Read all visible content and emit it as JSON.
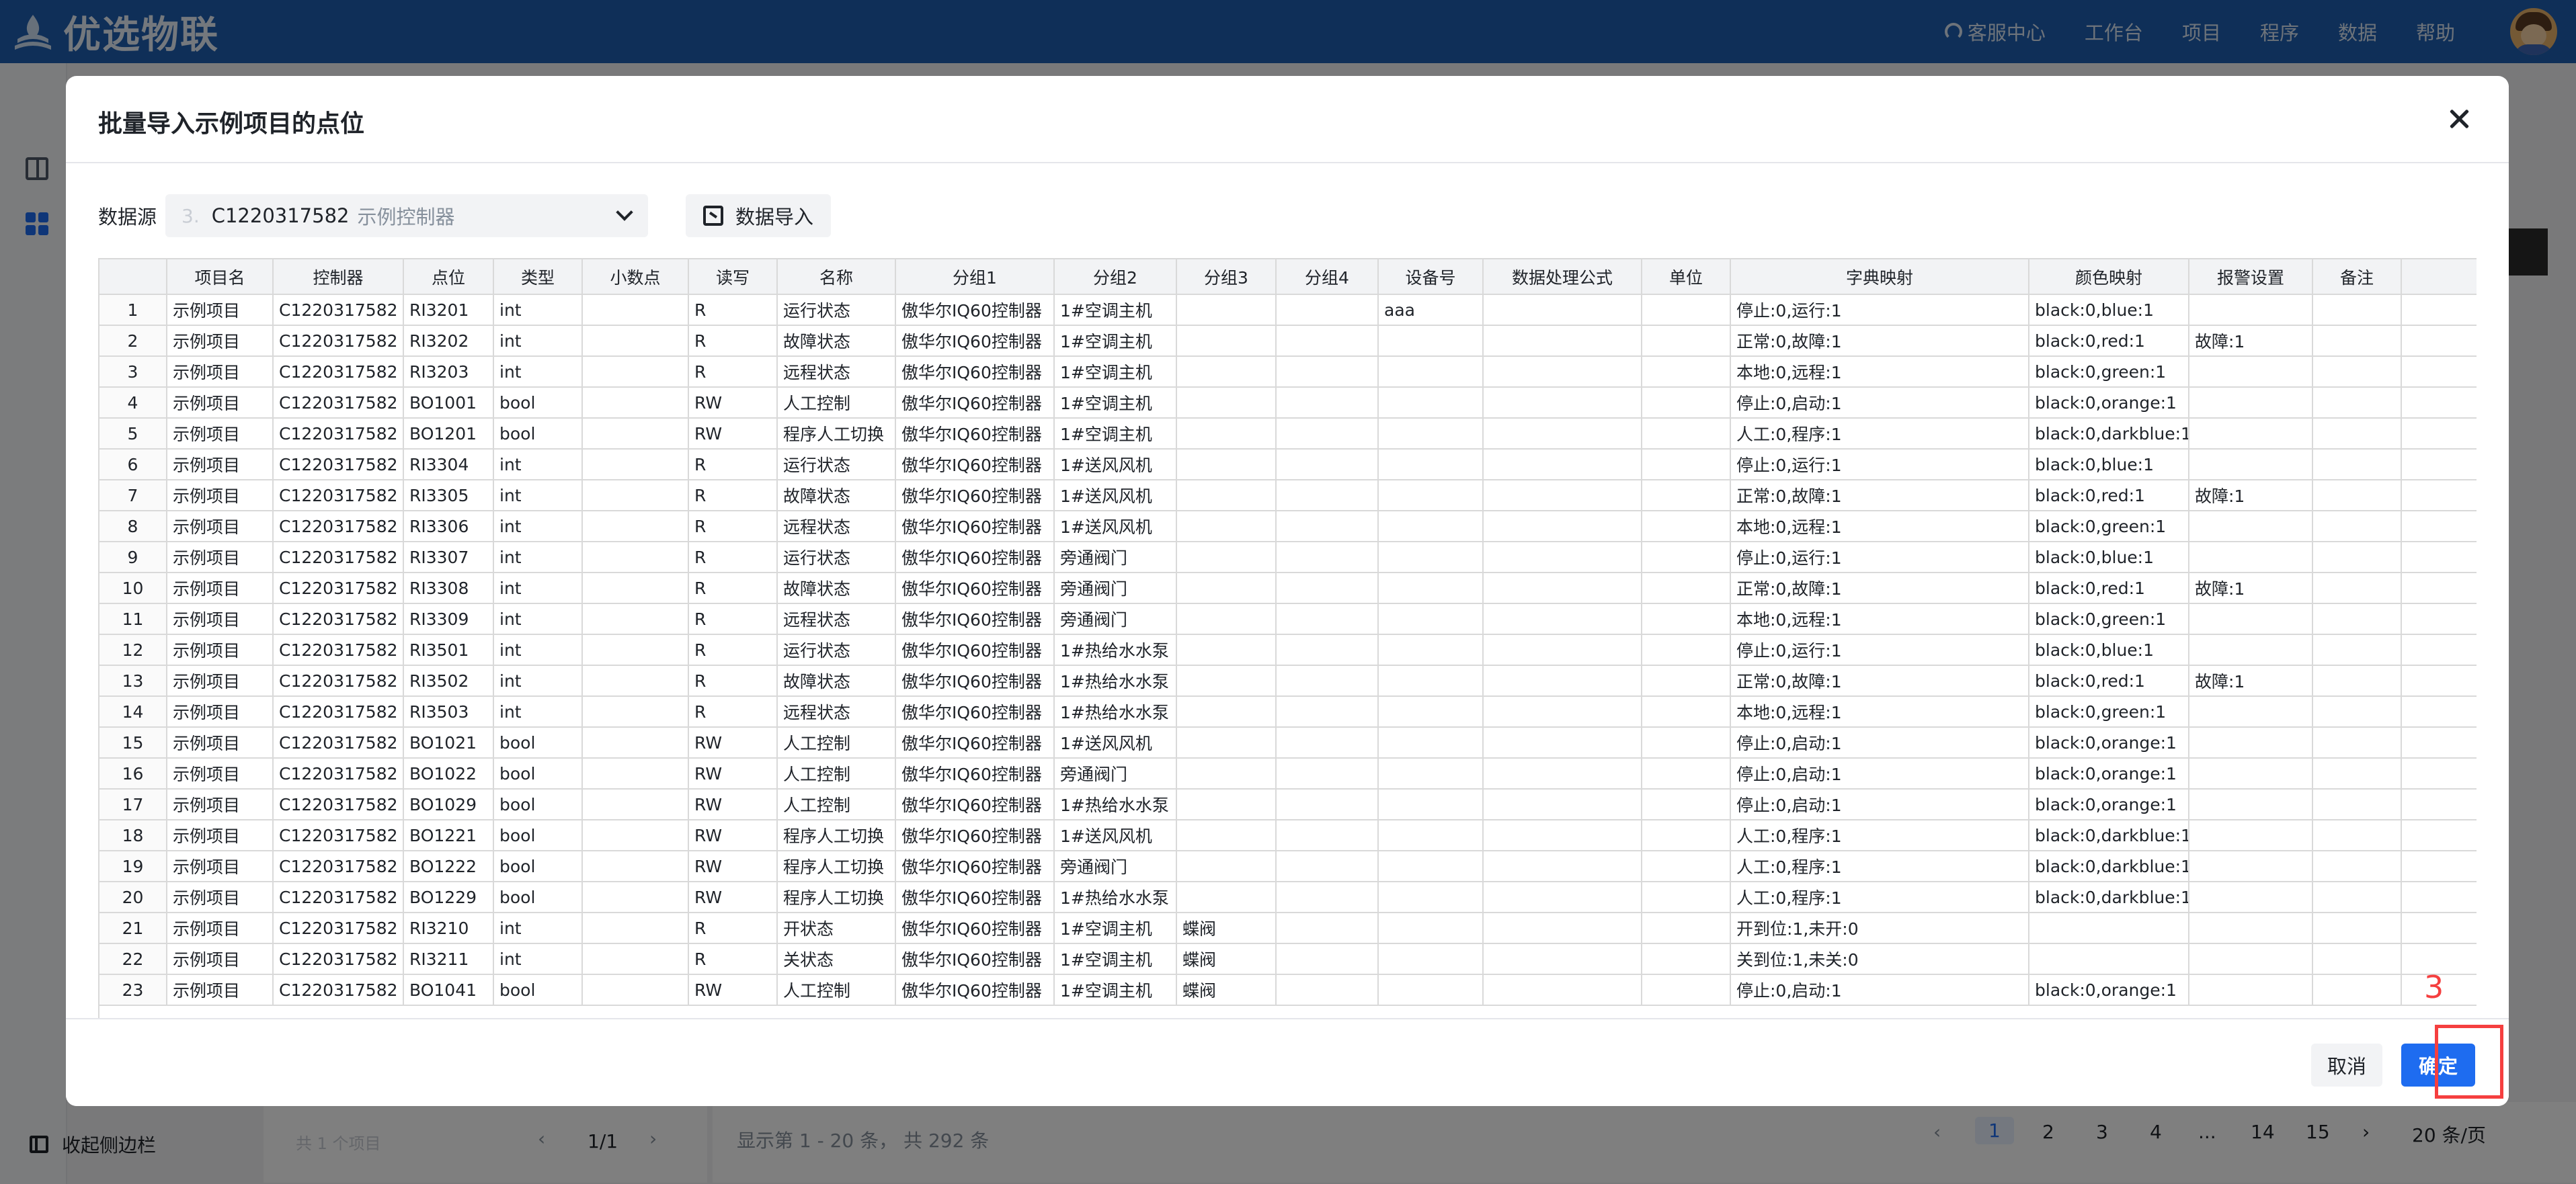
{
  "app": {
    "logo_text": "优选物联",
    "nav": [
      {
        "label": "客服中心",
        "icon": "headset-icon"
      },
      {
        "label": "工作台"
      },
      {
        "label": "项目"
      },
      {
        "label": "程序"
      },
      {
        "label": "数据"
      },
      {
        "label": "帮助"
      }
    ],
    "collapse_label": "收起侧边栏",
    "left_footer": {
      "count": "共 1 个项目",
      "page": "1/1"
    },
    "right_footer": {
      "summary": "显示第 1 - 20 条， 共 292 条",
      "pages": [
        "1",
        "2",
        "3",
        "4",
        "...",
        "14",
        "15"
      ],
      "page_size": "20 条/页"
    }
  },
  "modal": {
    "title": "批量导入示例项目的点位",
    "datasource_label": "数据源",
    "datasource_index": "3.",
    "datasource_value": "C1220317582",
    "datasource_sub": "示例控制器",
    "import_button": "数据导入",
    "cancel_button": "取消",
    "ok_button": "确定"
  },
  "annotation": {
    "number": "3",
    "color": "#f53f3f"
  },
  "colors": {
    "primary": "#1e6cf0",
    "topbar": "#1f5fb0"
  },
  "table": {
    "columns": [
      "",
      "项目名",
      "控制器",
      "点位",
      "类型",
      "小数点",
      "读写",
      "名称",
      "分组1",
      "分组2",
      "分组3",
      "分组4",
      "设备号",
      "数据处理公式",
      "单位",
      "字典映射",
      "颜色映射",
      "报警设置",
      "备注",
      ""
    ],
    "rows": [
      [
        "1",
        "示例项目",
        "C1220317582",
        "RI3201",
        "int",
        "",
        "R",
        "运行状态",
        "傲华尔IQ60控制器",
        "1#空调主机",
        "",
        "",
        "aaa",
        "",
        "",
        "停止:0,运行:1",
        "black:0,blue:1",
        "",
        ""
      ],
      [
        "2",
        "示例项目",
        "C1220317582",
        "RI3202",
        "int",
        "",
        "R",
        "故障状态",
        "傲华尔IQ60控制器",
        "1#空调主机",
        "",
        "",
        "",
        "",
        "",
        "正常:0,故障:1",
        "black:0,red:1",
        "故障:1",
        ""
      ],
      [
        "3",
        "示例项目",
        "C1220317582",
        "RI3203",
        "int",
        "",
        "R",
        "远程状态",
        "傲华尔IQ60控制器",
        "1#空调主机",
        "",
        "",
        "",
        "",
        "",
        "本地:0,远程:1",
        "black:0,green:1",
        "",
        ""
      ],
      [
        "4",
        "示例项目",
        "C1220317582",
        "BO1001",
        "bool",
        "",
        "RW",
        "人工控制",
        "傲华尔IQ60控制器",
        "1#空调主机",
        "",
        "",
        "",
        "",
        "",
        "停止:0,启动:1",
        "black:0,orange:1",
        "",
        ""
      ],
      [
        "5",
        "示例项目",
        "C1220317582",
        "BO1201",
        "bool",
        "",
        "RW",
        "程序人工切换",
        "傲华尔IQ60控制器",
        "1#空调主机",
        "",
        "",
        "",
        "",
        "",
        "人工:0,程序:1",
        "black:0,darkblue:1",
        "",
        ""
      ],
      [
        "6",
        "示例项目",
        "C1220317582",
        "RI3304",
        "int",
        "",
        "R",
        "运行状态",
        "傲华尔IQ60控制器",
        "1#送风风机",
        "",
        "",
        "",
        "",
        "",
        "停止:0,运行:1",
        "black:0,blue:1",
        "",
        ""
      ],
      [
        "7",
        "示例项目",
        "C1220317582",
        "RI3305",
        "int",
        "",
        "R",
        "故障状态",
        "傲华尔IQ60控制器",
        "1#送风风机",
        "",
        "",
        "",
        "",
        "",
        "正常:0,故障:1",
        "black:0,red:1",
        "故障:1",
        ""
      ],
      [
        "8",
        "示例项目",
        "C1220317582",
        "RI3306",
        "int",
        "",
        "R",
        "远程状态",
        "傲华尔IQ60控制器",
        "1#送风风机",
        "",
        "",
        "",
        "",
        "",
        "本地:0,远程:1",
        "black:0,green:1",
        "",
        ""
      ],
      [
        "9",
        "示例项目",
        "C1220317582",
        "RI3307",
        "int",
        "",
        "R",
        "运行状态",
        "傲华尔IQ60控制器",
        "旁通阀门",
        "",
        "",
        "",
        "",
        "",
        "停止:0,运行:1",
        "black:0,blue:1",
        "",
        ""
      ],
      [
        "10",
        "示例项目",
        "C1220317582",
        "RI3308",
        "int",
        "",
        "R",
        "故障状态",
        "傲华尔IQ60控制器",
        "旁通阀门",
        "",
        "",
        "",
        "",
        "",
        "正常:0,故障:1",
        "black:0,red:1",
        "故障:1",
        ""
      ],
      [
        "11",
        "示例项目",
        "C1220317582",
        "RI3309",
        "int",
        "",
        "R",
        "远程状态",
        "傲华尔IQ60控制器",
        "旁通阀门",
        "",
        "",
        "",
        "",
        "",
        "本地:0,远程:1",
        "black:0,green:1",
        "",
        ""
      ],
      [
        "12",
        "示例项目",
        "C1220317582",
        "RI3501",
        "int",
        "",
        "R",
        "运行状态",
        "傲华尔IQ60控制器",
        "1#热给水水泵",
        "",
        "",
        "",
        "",
        "",
        "停止:0,运行:1",
        "black:0,blue:1",
        "",
        ""
      ],
      [
        "13",
        "示例项目",
        "C1220317582",
        "RI3502",
        "int",
        "",
        "R",
        "故障状态",
        "傲华尔IQ60控制器",
        "1#热给水水泵",
        "",
        "",
        "",
        "",
        "",
        "正常:0,故障:1",
        "black:0,red:1",
        "故障:1",
        ""
      ],
      [
        "14",
        "示例项目",
        "C1220317582",
        "RI3503",
        "int",
        "",
        "R",
        "远程状态",
        "傲华尔IQ60控制器",
        "1#热给水水泵",
        "",
        "",
        "",
        "",
        "",
        "本地:0,远程:1",
        "black:0,green:1",
        "",
        ""
      ],
      [
        "15",
        "示例项目",
        "C1220317582",
        "BO1021",
        "bool",
        "",
        "RW",
        "人工控制",
        "傲华尔IQ60控制器",
        "1#送风风机",
        "",
        "",
        "",
        "",
        "",
        "停止:0,启动:1",
        "black:0,orange:1",
        "",
        ""
      ],
      [
        "16",
        "示例项目",
        "C1220317582",
        "BO1022",
        "bool",
        "",
        "RW",
        "人工控制",
        "傲华尔IQ60控制器",
        "旁通阀门",
        "",
        "",
        "",
        "",
        "",
        "停止:0,启动:1",
        "black:0,orange:1",
        "",
        ""
      ],
      [
        "17",
        "示例项目",
        "C1220317582",
        "BO1029",
        "bool",
        "",
        "RW",
        "人工控制",
        "傲华尔IQ60控制器",
        "1#热给水水泵",
        "",
        "",
        "",
        "",
        "",
        "停止:0,启动:1",
        "black:0,orange:1",
        "",
        ""
      ],
      [
        "18",
        "示例项目",
        "C1220317582",
        "BO1221",
        "bool",
        "",
        "RW",
        "程序人工切换",
        "傲华尔IQ60控制器",
        "1#送风风机",
        "",
        "",
        "",
        "",
        "",
        "人工:0,程序:1",
        "black:0,darkblue:1",
        "",
        ""
      ],
      [
        "19",
        "示例项目",
        "C1220317582",
        "BO1222",
        "bool",
        "",
        "RW",
        "程序人工切换",
        "傲华尔IQ60控制器",
        "旁通阀门",
        "",
        "",
        "",
        "",
        "",
        "人工:0,程序:1",
        "black:0,darkblue:1",
        "",
        ""
      ],
      [
        "20",
        "示例项目",
        "C1220317582",
        "BO1229",
        "bool",
        "",
        "RW",
        "程序人工切换",
        "傲华尔IQ60控制器",
        "1#热给水水泵",
        "",
        "",
        "",
        "",
        "",
        "人工:0,程序:1",
        "black:0,darkblue:1",
        "",
        ""
      ],
      [
        "21",
        "示例项目",
        "C1220317582",
        "RI3210",
        "int",
        "",
        "R",
        "开状态",
        "傲华尔IQ60控制器",
        "1#空调主机",
        "蝶阀",
        "",
        "",
        "",
        "",
        "开到位:1,未开:0",
        "",
        "",
        ""
      ],
      [
        "22",
        "示例项目",
        "C1220317582",
        "RI3211",
        "int",
        "",
        "R",
        "关状态",
        "傲华尔IQ60控制器",
        "1#空调主机",
        "蝶阀",
        "",
        "",
        "",
        "",
        "关到位:1,未关:0",
        "",
        "",
        ""
      ],
      [
        "23",
        "示例项目",
        "C1220317582",
        "BO1041",
        "bool",
        "",
        "RW",
        "人工控制",
        "傲华尔IQ60控制器",
        "1#空调主机",
        "蝶阀",
        "",
        "",
        "",
        "",
        "停止:0,启动:1",
        "black:0,orange:1",
        "",
        ""
      ]
    ]
  }
}
